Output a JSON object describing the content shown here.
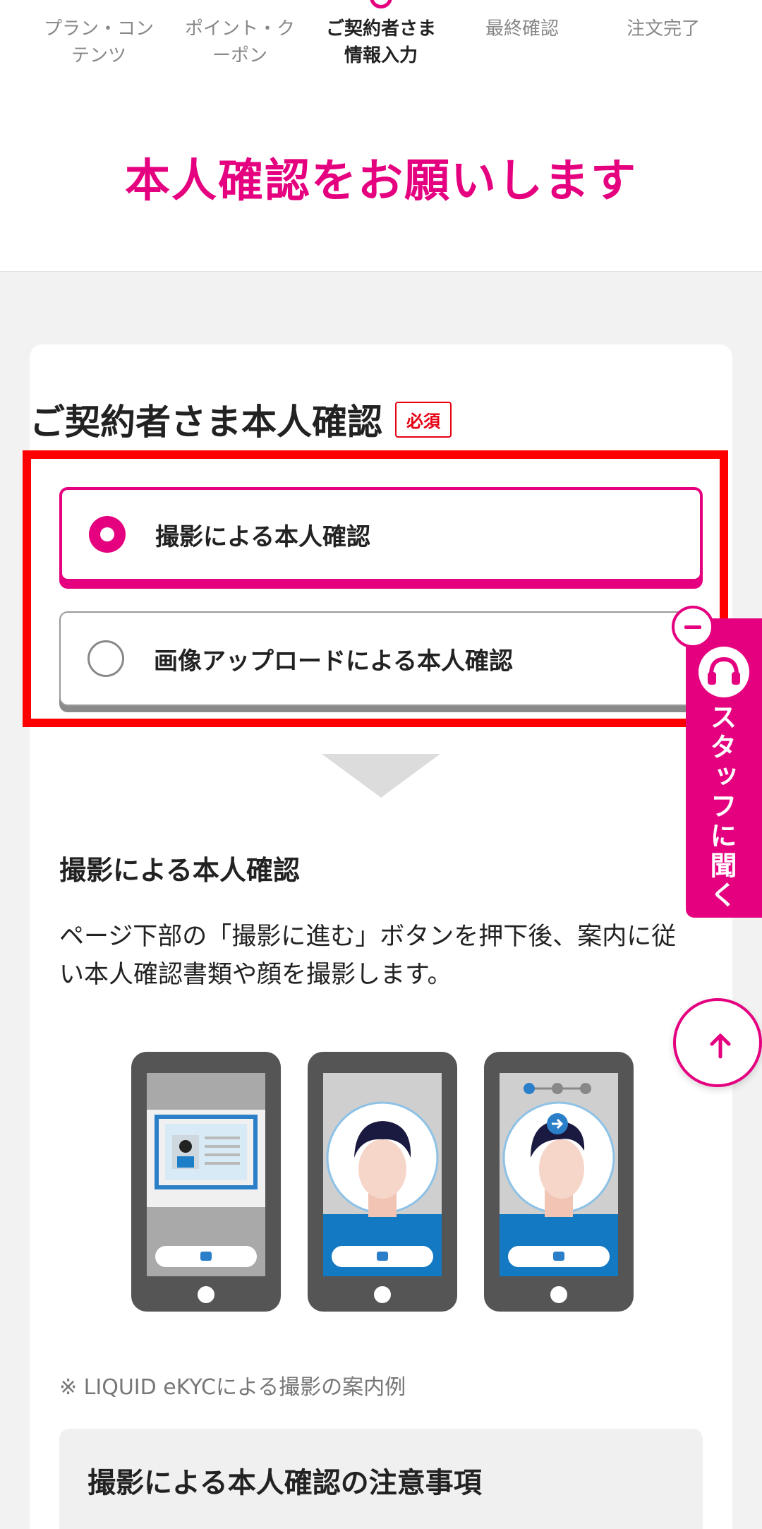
{
  "steps": [
    {
      "label": "プラン・コン\nテンツ"
    },
    {
      "label": "ポイント・ク\nーポン"
    },
    {
      "label": "ご契約者さま\n情報入力"
    },
    {
      "label": "最終確認"
    },
    {
      "label": "注文完了"
    }
  ],
  "page_title": "本人確認をお願いします",
  "section": {
    "title": "ご契約者さま本人確認",
    "required_badge": "必須"
  },
  "options": [
    {
      "label": "撮影による本人確認",
      "selected": true
    },
    {
      "label": "画像アップロードによる本人確認",
      "selected": false
    }
  ],
  "detail": {
    "title": "撮影による本人確認",
    "description": "ページ下部の「撮影に進む」ボタンを押下後、案内に従い本人確認書類や顔を撮影します。",
    "note": "※ LIQUID eKYCによる撮影の案内例"
  },
  "caution": {
    "title": "撮影による本人確認の注意事項"
  },
  "staff_tab": {
    "label": "スタッフに聞く"
  },
  "colors": {
    "accent": "#e5007f",
    "required": "#e50012",
    "highlight": "#ff0000"
  },
  "icons": {
    "headset": "headset-icon",
    "scroll_top": "arrow-up-icon",
    "collapse": "minus-icon"
  }
}
